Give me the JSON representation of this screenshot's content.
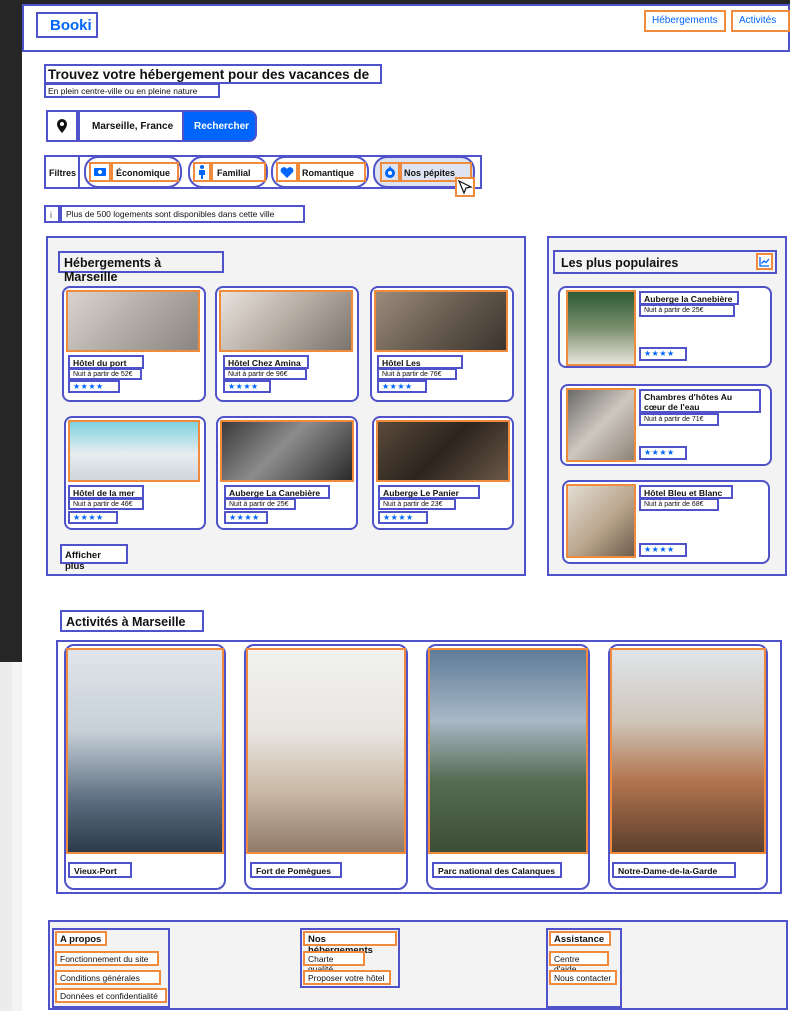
{
  "header": {
    "logo": "Booki",
    "nav": [
      "Hébergements",
      "Activités"
    ]
  },
  "hero": {
    "title": "Trouvez votre hébergement pour des vacances de rêve",
    "subtitle": "En plein centre-ville ou en pleine nature"
  },
  "search": {
    "value": "Marseille, France",
    "button": "Rechercher"
  },
  "filters": {
    "label": "Filtres",
    "items": [
      "Économique",
      "Familial",
      "Romantique",
      "Nos pépites"
    ]
  },
  "info": {
    "text": "Plus de 500 logements sont disponibles dans cette ville"
  },
  "hebergements": {
    "title": "Hébergements à Marseille",
    "more": "Afficher plus",
    "cards": [
      {
        "name": "Hôtel du port",
        "price": "Nuit à partir de 52€",
        "stars": "★★★★"
      },
      {
        "name": "Hôtel Chez Amina",
        "price": "Nuit à partir de 96€",
        "stars": "★★★★"
      },
      {
        "name": "Hôtel Les mouettes",
        "price": "Nuit à partir de 76€",
        "stars": "★★★★"
      },
      {
        "name": "Hôtel de la mer",
        "price": "Nuit à partir de 46€",
        "stars": "★★★★"
      },
      {
        "name": "Auberge La Canebière",
        "price": "Nuit à partir de 25€",
        "stars": "★★★★"
      },
      {
        "name": "Auberge Le Panier",
        "price": "Nuit à partir de 23€",
        "stars": "★★★★"
      }
    ]
  },
  "populaires": {
    "title": "Les plus populaires",
    "cards": [
      {
        "name": "Auberge la Canebière",
        "price": "Nuit à partir de 25€",
        "stars": "★★★★"
      },
      {
        "name": "Chambres d'hôtes Au cœur de l'eau",
        "price": "Nuit à partir de 71€",
        "stars": "★★★★"
      },
      {
        "name": "Hôtel Bleu et Blanc",
        "price": "Nuit à partir de 68€",
        "stars": "★★★★"
      }
    ]
  },
  "activites": {
    "title": "Activités à Marseille",
    "cards": [
      "Vieux-Port",
      "Fort de Pomègues",
      "Parc national des Calanques",
      "Notre-Dame-de-la-Garde"
    ]
  },
  "footer": {
    "cols": [
      {
        "title": "A propos",
        "links": [
          "Fonctionnement du site",
          "Conditions générales",
          "Données et confidentialité"
        ]
      },
      {
        "title": "Nos hébergements",
        "links": [
          "Charte qualité",
          "Proposer votre hôtel"
        ]
      },
      {
        "title": "Assistance",
        "links": [
          "Centre d'aide",
          "Nous contacter"
        ]
      }
    ]
  },
  "colors": {
    "accent": "#0065fc",
    "annotation_blue": "#4f52c8",
    "annotation_orange": "#f08a3c"
  }
}
